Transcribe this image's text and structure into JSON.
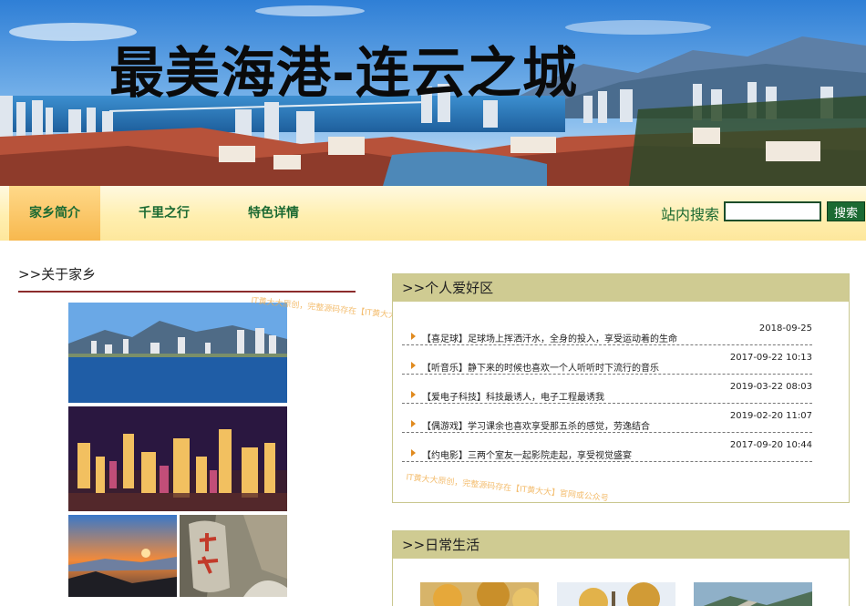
{
  "banner": {
    "title": "最美海港-连云之城"
  },
  "nav": {
    "items": [
      {
        "label": "家乡简介",
        "active": true
      },
      {
        "label": "千里之行",
        "active": false
      },
      {
        "label": "特色详情",
        "active": false
      }
    ],
    "search_label": "站内搜索",
    "search_value": "",
    "search_button": "搜索"
  },
  "about": {
    "title": ">>关于家乡"
  },
  "hobby": {
    "title": ">>个人爱好区",
    "items": [
      {
        "text": "【喜足球】足球场上挥洒汗水，全身的投入，享受运动着的生命",
        "date": "2018-09-25"
      },
      {
        "text": "【听音乐】静下来的时候也喜欢一个人听听时下流行的音乐",
        "date": "2017-09-22 10:13"
      },
      {
        "text": "【爱电子科技】科技最诱人，电子工程最诱我",
        "date": "2019-03-22 08:03"
      },
      {
        "text": "【偶游戏】学习课余也喜欢享受那五杀的感觉，劳逸结合",
        "date": "2019-02-20 11:07"
      },
      {
        "text": "【约电影】三两个室友一起影院走起，享受视觉盛宴",
        "date": "2017-09-20 10:44"
      }
    ]
  },
  "daily": {
    "title": ">>日常生活"
  },
  "watermark": {
    "text": "IT黄大大原创，完整源码存在【IT黄大大】官网或公众号"
  },
  "colors": {
    "nav_text": "#1b6a32",
    "panel_header": "#cfcb92",
    "accent_rule": "#8c2c2c",
    "arrow": "#e08a1e"
  }
}
